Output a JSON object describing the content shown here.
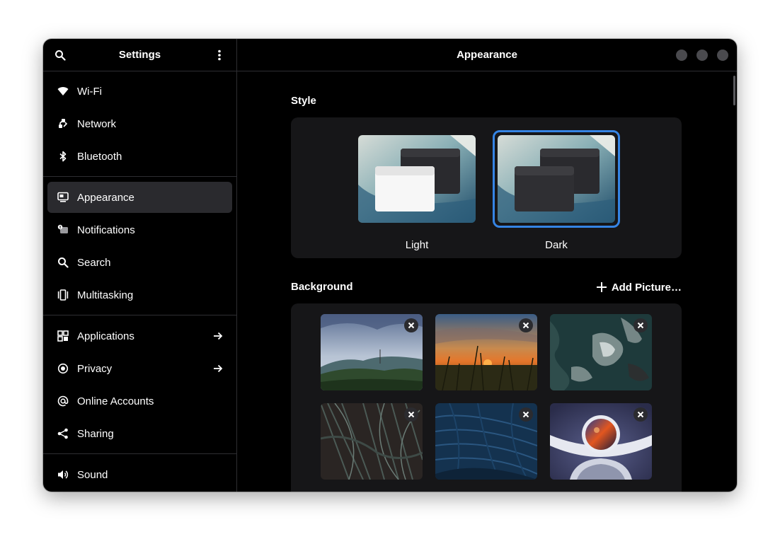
{
  "sidebar": {
    "title": "Settings",
    "search_icon": "search-icon",
    "menu_icon": "vertical-dots-menu-icon",
    "groups": [
      [
        {
          "label": "Wi-Fi",
          "icon": "wifi-icon"
        },
        {
          "label": "Network",
          "icon": "network-icon"
        },
        {
          "label": "Bluetooth",
          "icon": "bluetooth-icon"
        }
      ],
      [
        {
          "label": "Appearance",
          "icon": "appearance-icon",
          "active": true
        },
        {
          "label": "Notifications",
          "icon": "notifications-icon"
        },
        {
          "label": "Search",
          "icon": "search-icon"
        },
        {
          "label": "Multitasking",
          "icon": "multitasking-icon"
        }
      ],
      [
        {
          "label": "Applications",
          "icon": "applications-icon",
          "arrow": true
        },
        {
          "label": "Privacy",
          "icon": "privacy-icon",
          "arrow": true
        },
        {
          "label": "Online Accounts",
          "icon": "online-accounts-icon"
        },
        {
          "label": "Sharing",
          "icon": "sharing-icon"
        }
      ],
      [
        {
          "label": "Sound",
          "icon": "sound-icon"
        }
      ]
    ]
  },
  "main": {
    "title": "Appearance",
    "style": {
      "heading": "Style",
      "options": [
        {
          "label": "Light",
          "selected": false
        },
        {
          "label": "Dark",
          "selected": true
        }
      ]
    },
    "background": {
      "heading": "Background",
      "add_label": "Add Picture…",
      "wallpapers": [
        "mountain-hills",
        "sunset-field",
        "dark-sea-foam",
        "palm-leaves",
        "blue-leaves",
        "astronaut"
      ]
    }
  },
  "colors": {
    "accent": "#3584e4",
    "window_bg": "#000000",
    "card_bg": "#161618",
    "sidebar_active": "#2a2a2e"
  }
}
